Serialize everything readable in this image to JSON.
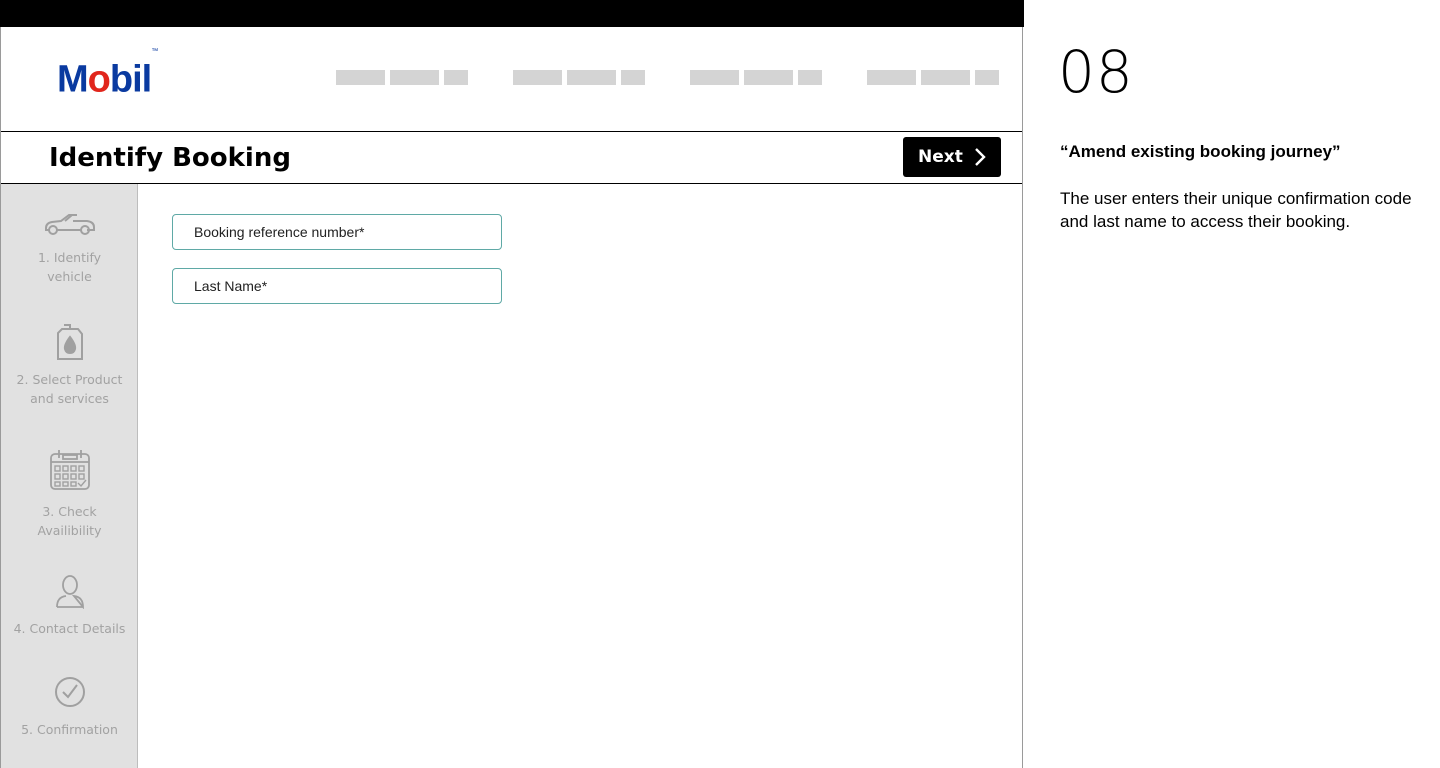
{
  "brand": {
    "name": "Mobil",
    "trademark": "™"
  },
  "header": {
    "nav_placeholders": [
      "nav-group-1",
      "nav-group-2",
      "nav-group-3",
      "nav-group-4"
    ]
  },
  "page": {
    "title": "Identify Booking",
    "next_label": "Next"
  },
  "steps": [
    {
      "label_line1": "1. Identify",
      "label_line2": "vehicle",
      "icon": "car-icon"
    },
    {
      "label_line1": "2. Select Product",
      "label_line2": "and services",
      "icon": "oil-can-icon"
    },
    {
      "label_line1": "3. Check",
      "label_line2": "Availibility",
      "icon": "calendar-icon"
    },
    {
      "label_line1": "4. Contact Details",
      "label_line2": "",
      "icon": "user-icon"
    },
    {
      "label_line1": "5. Confirmation",
      "label_line2": "",
      "icon": "check-circle-icon"
    }
  ],
  "form": {
    "booking_ref": {
      "placeholder": "Booking reference number*",
      "value": ""
    },
    "last_name": {
      "placeholder": "Last Name*",
      "value": ""
    }
  },
  "note": {
    "number": "08",
    "heading": "“Amend existing booking journey”",
    "body": "The user enters their unique confirmation code and last name to access their booking."
  },
  "colors": {
    "accent": "#0a3aa0",
    "logo_o": "#e1261c",
    "field_border": "#5fa9a6",
    "sidebar_bg": "#e1e1e1"
  }
}
